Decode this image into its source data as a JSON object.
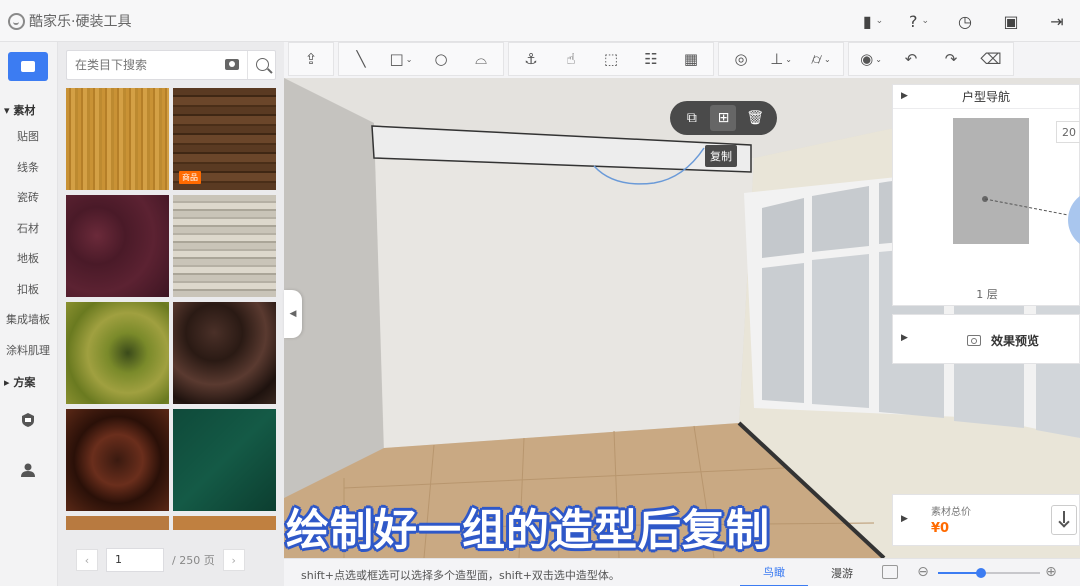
{
  "app": {
    "title": "酷家乐·硬装工具"
  },
  "topbar": {
    "icons": [
      {
        "name": "save-menu-icon",
        "glyph": "▮",
        "has_caret": true
      },
      {
        "name": "help-icon",
        "glyph": "?",
        "has_caret": true
      },
      {
        "name": "history-icon",
        "glyph": "◷",
        "has_caret": false
      },
      {
        "name": "save-icon",
        "glyph": "▣",
        "has_caret": false
      },
      {
        "name": "exit-icon",
        "glyph": "⇥",
        "has_caret": false
      }
    ]
  },
  "sidebar": {
    "section_materials": "▾ 素材",
    "items": [
      "贴图",
      "线条",
      "瓷砖",
      "石材",
      "地板",
      "扣板",
      "集成墙板",
      "涂料肌理"
    ],
    "section_scheme": "▸ 方案"
  },
  "material_panel": {
    "search_placeholder": "在类目下搜索",
    "badge": "商品",
    "page_current": "1",
    "page_total": "/ 250 页",
    "prev": "‹",
    "next": "›"
  },
  "toolbar": {
    "groups": [
      [
        {
          "name": "export-tool-icon",
          "glyph": "⇪"
        }
      ],
      [
        {
          "name": "line-tool-icon",
          "glyph": "╲"
        },
        {
          "name": "rectangle-tool-icon",
          "glyph": "□",
          "caret": "⌄"
        },
        {
          "name": "circle-tool-icon",
          "glyph": "○"
        },
        {
          "name": "arc-tool-icon",
          "glyph": "⌓"
        }
      ],
      [
        {
          "name": "anchor-tool-icon",
          "glyph": "⚓"
        },
        {
          "name": "hand-tool-icon",
          "glyph": "☝"
        },
        {
          "name": "frame-tool-icon",
          "glyph": "⬚"
        },
        {
          "name": "grid-tool-icon",
          "glyph": "☷"
        },
        {
          "name": "panel-tool-icon",
          "glyph": "▦"
        }
      ],
      [
        {
          "name": "measure-tool-icon",
          "glyph": "◎"
        },
        {
          "name": "align-tool-icon",
          "glyph": "⊥",
          "caret": "⌄"
        },
        {
          "name": "paint-tool-icon",
          "glyph": "⌭",
          "caret": "⌄"
        }
      ],
      [
        {
          "name": "visibility-tool-icon",
          "glyph": "◉",
          "caret": "⌄"
        },
        {
          "name": "undo-icon",
          "glyph": "↶"
        },
        {
          "name": "redo-icon",
          "glyph": "↷"
        },
        {
          "name": "erase-icon",
          "glyph": "⌫"
        }
      ]
    ]
  },
  "viewport": {
    "context_menu": [
      {
        "name": "select-face-icon",
        "glyph": "⧉"
      },
      {
        "name": "copy-icon",
        "glyph": "⊞"
      },
      {
        "name": "delete-icon",
        "glyph": "🗑"
      }
    ],
    "tooltip": "复制",
    "caption": "绘制好一组的造型后复制"
  },
  "nav_panel": {
    "title": "户型导航",
    "zoom": "20",
    "floor": "1 层"
  },
  "preview_panel": {
    "title": "效果预览"
  },
  "price_panel": {
    "label": "素材总价",
    "value": "¥0"
  },
  "status": {
    "hint": "shift+点选或框选可以选择多个造型面，shift+双击选中造型体。",
    "tab_bird": "鸟瞰",
    "tab_roam": "漫游",
    "zoom_level": 0.42,
    "zoom_out": "⊖",
    "zoom_in": "⊕"
  },
  "colors": {
    "accent": "#3c7cf2",
    "price": "#ff6a00",
    "caption_outline": "#2f58c8"
  }
}
